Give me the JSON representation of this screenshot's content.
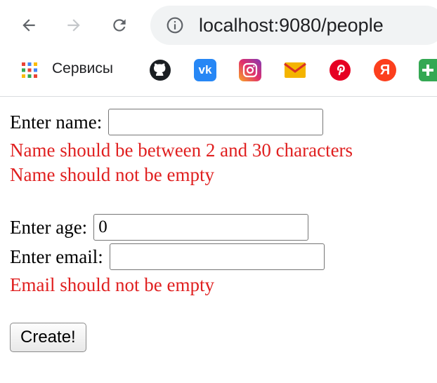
{
  "browser": {
    "url": "localhost:9080/people",
    "icons": [
      "back-arrow-icon",
      "forward-arrow-icon",
      "reload-icon",
      "site-info-icon"
    ],
    "bookmarks": {
      "services_label": "Сервисы",
      "items": [
        "github-icon",
        "vk-icon",
        "instagram-icon",
        "gmail-icon",
        "pinterest-icon",
        "yandex-icon",
        "green-plus-icon"
      ],
      "vk_text": "vk",
      "yandex_text": "Я"
    }
  },
  "form": {
    "name_label": "Enter name:",
    "name_value": "",
    "name_errors": [
      "Name should be between 2 and 30 characters",
      "Name should not be empty"
    ],
    "age_label": "Enter age:",
    "age_value": "0",
    "email_label": "Enter email:",
    "email_value": "",
    "email_errors": [
      "Email should not be empty"
    ],
    "submit_label": "Create!"
  },
  "colors": {
    "error": "#e02020",
    "omnibox": "#f1f3f4"
  }
}
